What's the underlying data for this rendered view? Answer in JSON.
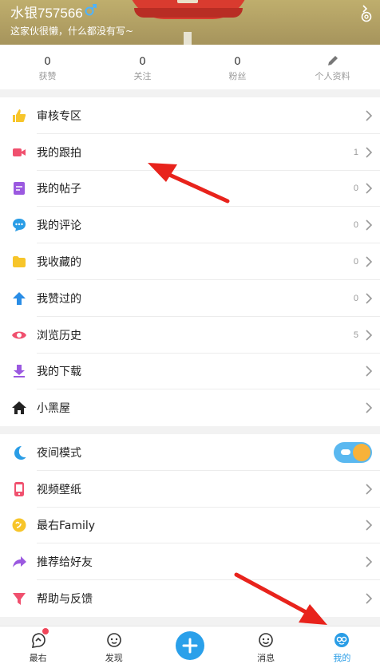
{
  "profile": {
    "username": "水银757566",
    "bio": "这家伙很懒，什么都没有写~"
  },
  "stats": [
    {
      "value": "0",
      "label": "获赞"
    },
    {
      "value": "0",
      "label": "关注"
    },
    {
      "value": "0",
      "label": "粉丝"
    },
    {
      "label": "个人资料"
    }
  ],
  "menu1": [
    {
      "label": "审核专区",
      "count": "",
      "icon": "thumbs-up-icon",
      "color": "#f7c52a"
    },
    {
      "label": "我的跟拍",
      "count": "1",
      "icon": "video-camera-icon",
      "color": "#f0506e"
    },
    {
      "label": "我的帖子",
      "count": "0",
      "icon": "document-icon",
      "color": "#9b59e0"
    },
    {
      "label": "我的评论",
      "count": "0",
      "icon": "chat-bubble-icon",
      "color": "#2a9de6"
    },
    {
      "label": "我收藏的",
      "count": "0",
      "icon": "folder-icon",
      "color": "#f7c52a"
    },
    {
      "label": "我赞过的",
      "count": "0",
      "icon": "arrow-up-icon",
      "color": "#2a8de6"
    },
    {
      "label": "浏览历史",
      "count": "5",
      "icon": "eye-icon",
      "color": "#f0506e"
    },
    {
      "label": "我的下载",
      "count": "",
      "icon": "download-icon",
      "color": "#9b59e0"
    },
    {
      "label": "小黑屋",
      "count": "",
      "icon": "house-icon",
      "color": "#222222"
    }
  ],
  "menu2": [
    {
      "label": "夜间模式",
      "icon": "moon-icon",
      "color": "#2a9de6"
    },
    {
      "label": "视频壁纸",
      "icon": "phone-icon",
      "color": "#f0506e"
    },
    {
      "label": "最右Family",
      "icon": "family-icon",
      "color": "#f7c52a"
    },
    {
      "label": "推荐给好友",
      "icon": "share-icon",
      "color": "#9b59e0"
    },
    {
      "label": "帮助与反馈",
      "icon": "funnel-icon",
      "color": "#f0506e"
    }
  ],
  "night_mode_on": true,
  "bottom_nav": [
    {
      "label": "最右",
      "icon": "zuiyou-icon",
      "badge": true
    },
    {
      "label": "发现",
      "icon": "discover-icon"
    },
    {
      "label": "",
      "icon": "plus-icon"
    },
    {
      "label": "消息",
      "icon": "message-icon"
    },
    {
      "label": "我的",
      "icon": "profile-icon",
      "active": true
    }
  ],
  "accent": "#2a9de6",
  "annotation_color": "#e8231c"
}
